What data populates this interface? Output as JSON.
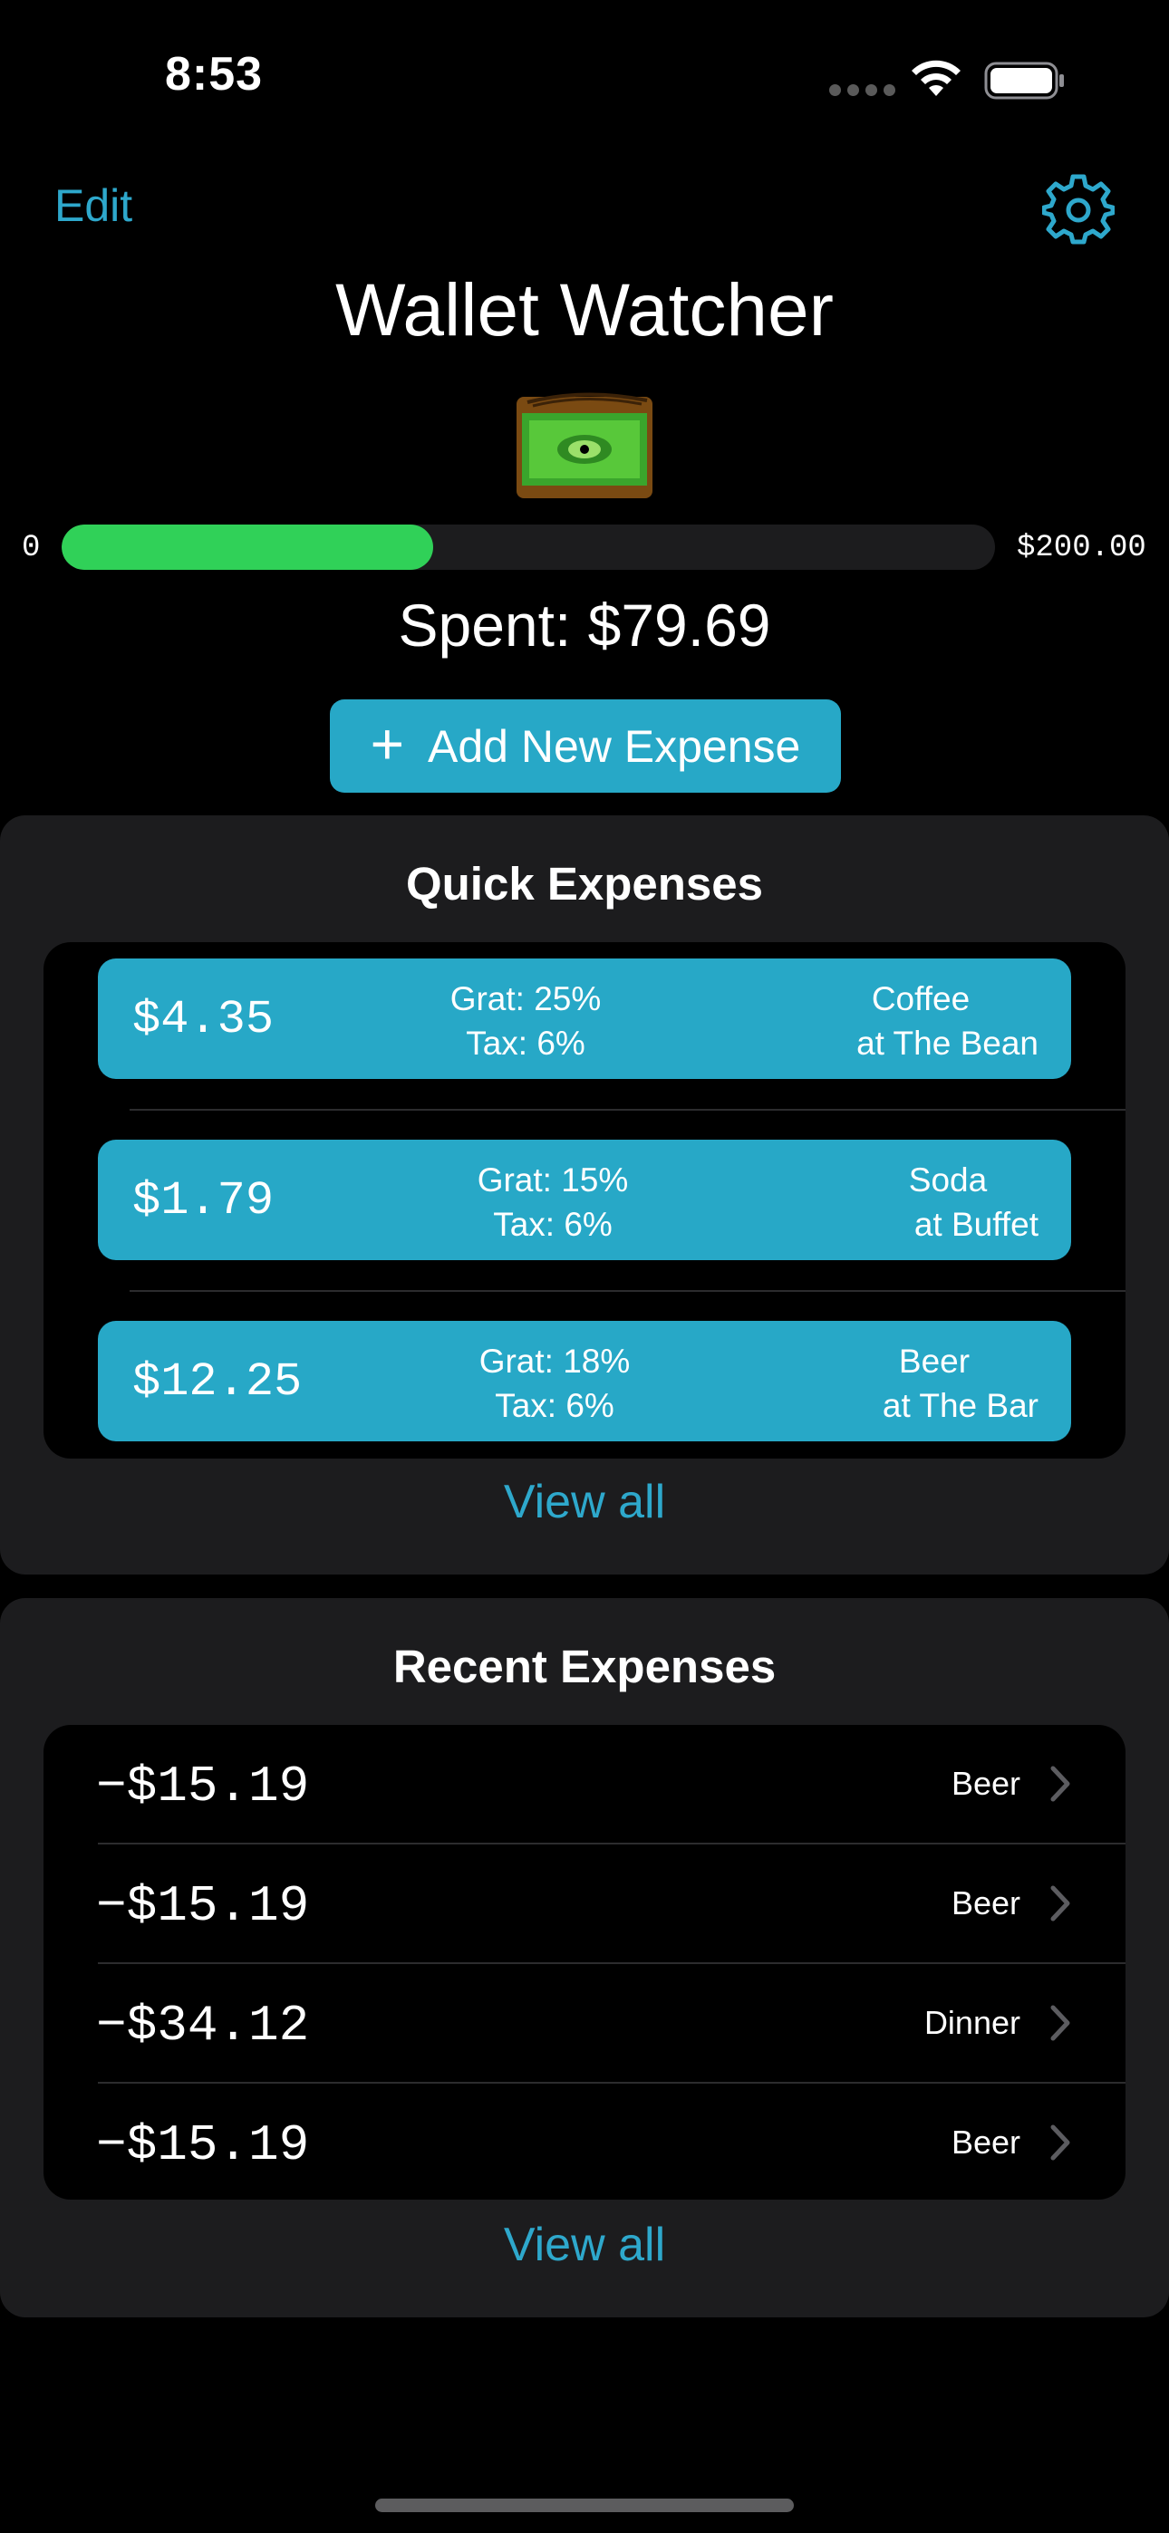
{
  "status_bar": {
    "time": "8:53"
  },
  "nav": {
    "edit_label": "Edit",
    "settings_icon": "gear-icon"
  },
  "header": {
    "title": "Wallet Watcher",
    "logo_icon": "wallet-eye-icon"
  },
  "budget": {
    "min_label": "0",
    "max_label": "$200.00",
    "progress_fraction": 0.3985,
    "spent_label": "Spent: $79.69"
  },
  "colors": {
    "accent": "#27a8c7",
    "link": "#2ea8cc",
    "progress": "#30d158",
    "panel": "#1c1c1e"
  },
  "actions": {
    "add_expense_label": "Add New Expense"
  },
  "quick_expenses": {
    "title": "Quick Expenses",
    "items": [
      {
        "amount": "$4.35",
        "grat": "Grat: 25%",
        "tax": "Tax: 6%",
        "name": "Coffee",
        "place": "at The Bean"
      },
      {
        "amount": "$1.79",
        "grat": "Grat: 15%",
        "tax": "Tax: 6%",
        "name": "Soda",
        "place": "at Buffet"
      },
      {
        "amount": "$12.25",
        "grat": "Grat: 18%",
        "tax": "Tax: 6%",
        "name": "Beer",
        "place": "at The Bar"
      }
    ],
    "view_all_label": "View all"
  },
  "recent_expenses": {
    "title": "Recent Expenses",
    "items": [
      {
        "amount": "−$15.19",
        "label": "Beer"
      },
      {
        "amount": "−$15.19",
        "label": "Beer"
      },
      {
        "amount": "−$34.12",
        "label": "Dinner"
      },
      {
        "amount": "−$15.19",
        "label": "Beer"
      }
    ],
    "view_all_label": "View all"
  }
}
